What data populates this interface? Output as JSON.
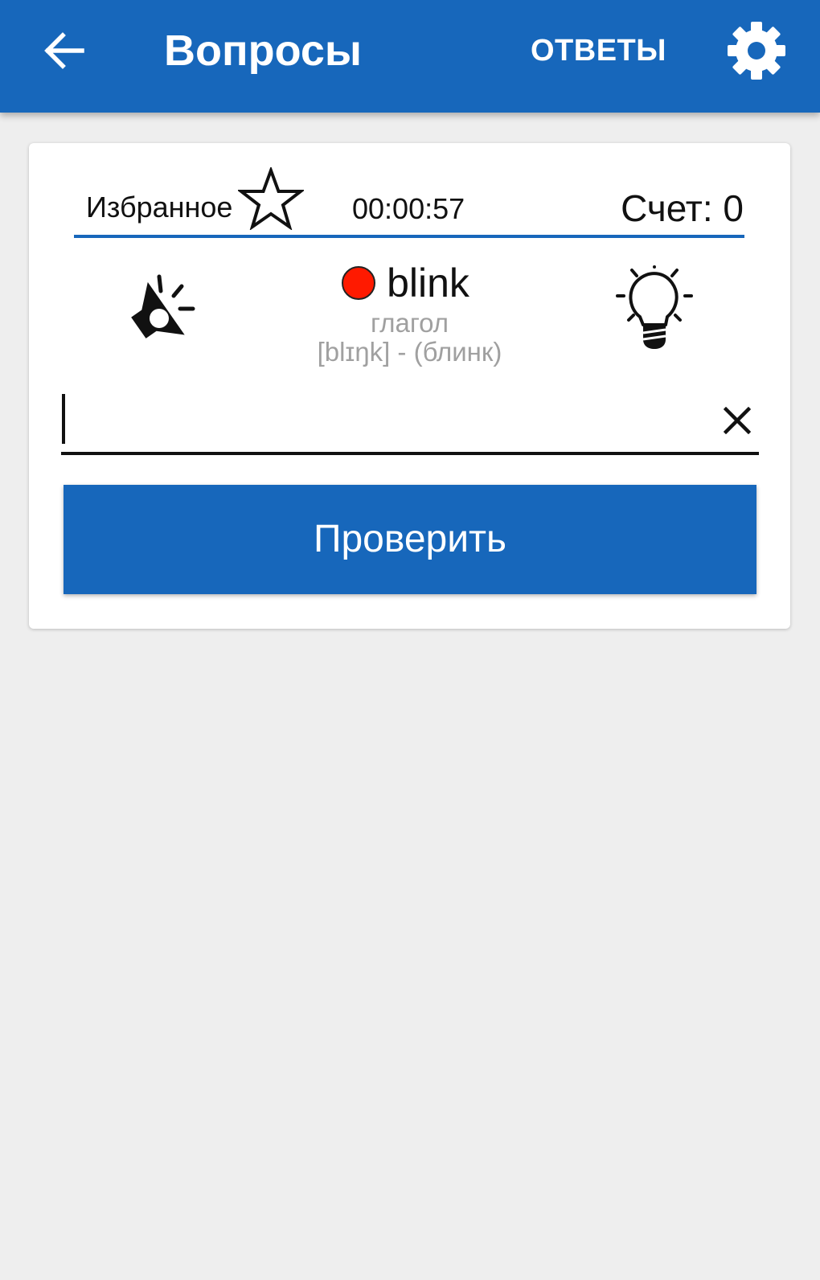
{
  "appbar": {
    "title": "Вопросы",
    "answers_label": "ОТВЕТЫ",
    "back_icon": "arrow-left-icon",
    "settings_icon": "gear-icon"
  },
  "card": {
    "favorites_label": "Избранное",
    "favorite_icon": "star-outline-icon",
    "timer": "00:00:57",
    "score": "Счет: 0",
    "word": "blink",
    "part_of_speech": "глагол",
    "transcription": "[blɪŋk] - (блинк)",
    "answer_value": "",
    "check_label": "Проверить",
    "speaker_icon": "speaker-icon",
    "hint_icon": "lightbulb-icon",
    "clear_icon": "close-icon"
  },
  "colors": {
    "primary": "#1767bb",
    "status_dot": "#ff1a00",
    "background": "#eeeeee",
    "secondary_text": "#a0a0a0"
  }
}
